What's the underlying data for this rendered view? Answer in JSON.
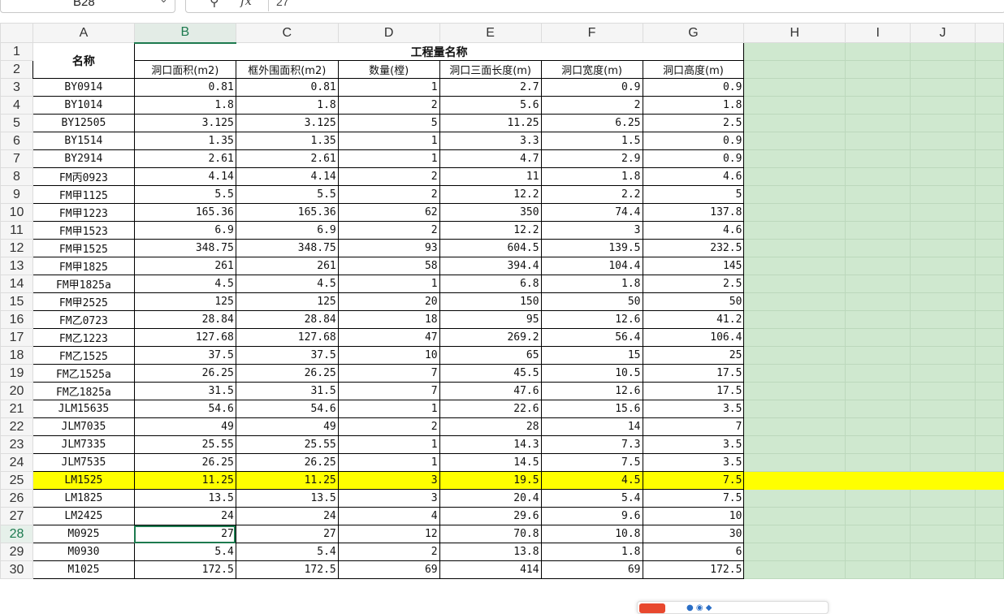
{
  "formula_bar": {
    "cell_ref": "B28",
    "fx_symbol": "fx",
    "value": "27"
  },
  "columns": [
    "A",
    "B",
    "C",
    "D",
    "E",
    "F",
    "G",
    "H",
    "I",
    "J"
  ],
  "selected_column": "B",
  "selected_row": "28",
  "header": {
    "name_label": "名称",
    "group_title": "工程量名称",
    "sub_headers": [
      "洞口面积(m2)",
      "框外围面积(m2)",
      "数量(樘)",
      "洞口三面长度(m)",
      "洞口宽度(m)",
      "洞口高度(m)"
    ]
  },
  "rows": [
    [
      "3",
      "BY0914",
      "0.81",
      "0.81",
      "1",
      "2.7",
      "0.9",
      "0.9"
    ],
    [
      "4",
      "BY1014",
      "1.8",
      "1.8",
      "2",
      "5.6",
      "2",
      "1.8"
    ],
    [
      "5",
      "BY12505",
      "3.125",
      "3.125",
      "5",
      "11.25",
      "6.25",
      "2.5"
    ],
    [
      "6",
      "BY1514",
      "1.35",
      "1.35",
      "1",
      "3.3",
      "1.5",
      "0.9"
    ],
    [
      "7",
      "BY2914",
      "2.61",
      "2.61",
      "1",
      "4.7",
      "2.9",
      "0.9"
    ],
    [
      "8",
      "FM丙0923",
      "4.14",
      "4.14",
      "2",
      "11",
      "1.8",
      "4.6"
    ],
    [
      "9",
      "FM甲1125",
      "5.5",
      "5.5",
      "2",
      "12.2",
      "2.2",
      "5"
    ],
    [
      "10",
      "FM甲1223",
      "165.36",
      "165.36",
      "62",
      "350",
      "74.4",
      "137.8"
    ],
    [
      "11",
      "FM甲1523",
      "6.9",
      "6.9",
      "2",
      "12.2",
      "3",
      "4.6"
    ],
    [
      "12",
      "FM甲1525",
      "348.75",
      "348.75",
      "93",
      "604.5",
      "139.5",
      "232.5"
    ],
    [
      "13",
      "FM甲1825",
      "261",
      "261",
      "58",
      "394.4",
      "104.4",
      "145"
    ],
    [
      "14",
      "FM甲1825a",
      "4.5",
      "4.5",
      "1",
      "6.8",
      "1.8",
      "2.5"
    ],
    [
      "15",
      "FM甲2525",
      "125",
      "125",
      "20",
      "150",
      "50",
      "50"
    ],
    [
      "16",
      "FM乙0723",
      "28.84",
      "28.84",
      "18",
      "95",
      "12.6",
      "41.2"
    ],
    [
      "17",
      "FM乙1223",
      "127.68",
      "127.68",
      "47",
      "269.2",
      "56.4",
      "106.4"
    ],
    [
      "18",
      "FM乙1525",
      "37.5",
      "37.5",
      "10",
      "65",
      "15",
      "25"
    ],
    [
      "19",
      "FM乙1525a",
      "26.25",
      "26.25",
      "7",
      "45.5",
      "10.5",
      "17.5"
    ],
    [
      "20",
      "FM乙1825a",
      "31.5",
      "31.5",
      "7",
      "47.6",
      "12.6",
      "17.5"
    ],
    [
      "21",
      "JLM15635",
      "54.6",
      "54.6",
      "1",
      "22.6",
      "15.6",
      "3.5"
    ],
    [
      "22",
      "JLM7035",
      "49",
      "49",
      "2",
      "28",
      "14",
      "7"
    ],
    [
      "23",
      "JLM7335",
      "25.55",
      "25.55",
      "1",
      "14.3",
      "7.3",
      "3.5"
    ],
    [
      "24",
      "JLM7535",
      "26.25",
      "26.25",
      "1",
      "14.5",
      "7.5",
      "3.5"
    ],
    [
      "25",
      "LM1525",
      "11.25",
      "11.25",
      "3",
      "19.5",
      "4.5",
      "7.5"
    ],
    [
      "26",
      "LM1825",
      "13.5",
      "13.5",
      "3",
      "20.4",
      "5.4",
      "7.5"
    ],
    [
      "27",
      "LM2425",
      "24",
      "24",
      "4",
      "29.6",
      "9.6",
      "10"
    ],
    [
      "28",
      "M0925",
      "27",
      "27",
      "12",
      "70.8",
      "10.8",
      "30"
    ],
    [
      "29",
      "M0930",
      "5.4",
      "5.4",
      "2",
      "13.8",
      "1.8",
      "6"
    ],
    [
      "30",
      "M1025",
      "172.5",
      "172.5",
      "69",
      "414",
      "69",
      "172.5"
    ]
  ],
  "highlighted_row": "25",
  "colors": {
    "highlight": "#ffff00",
    "selection": "#1d7a4f",
    "side_fill": "#cfe8cf"
  }
}
